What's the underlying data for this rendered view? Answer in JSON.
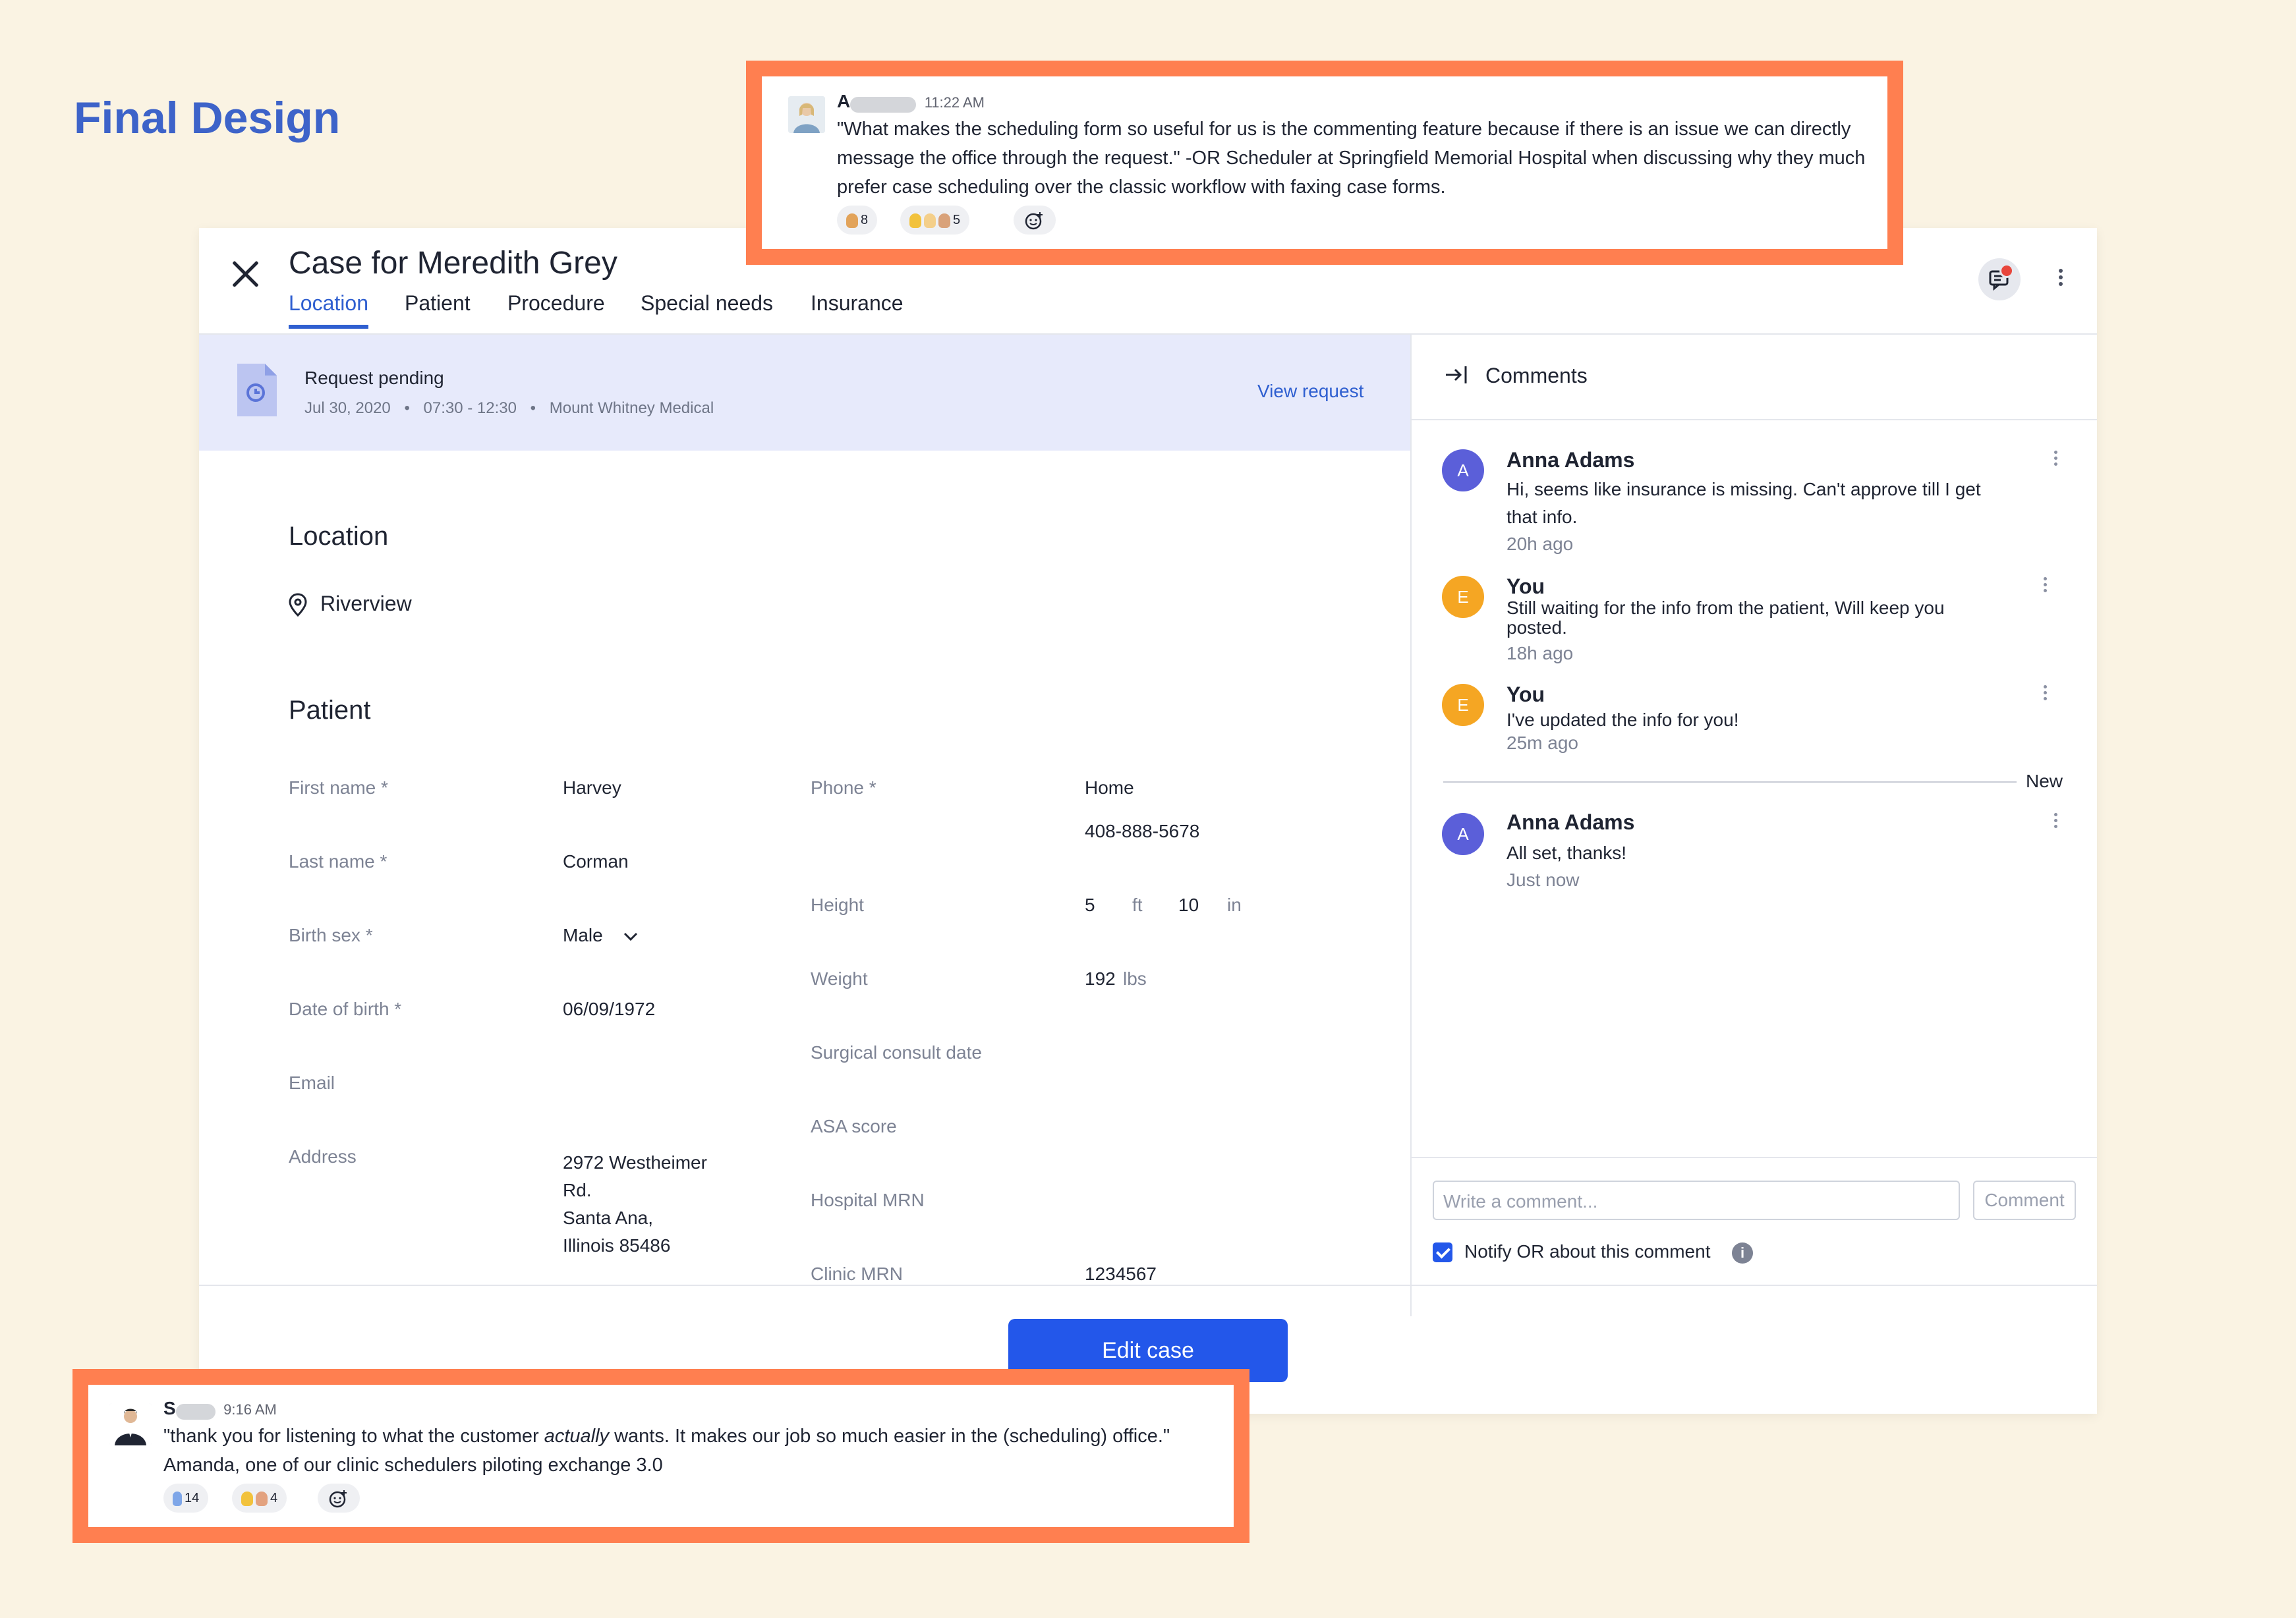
{
  "page": {
    "title": "Final Design"
  },
  "quote_top": {
    "name_initial": "A",
    "time": "11:22 AM",
    "text_line1": "\"What makes the scheduling form so useful for us is the commenting feature because if there is an issue we can directly",
    "text_line2": "message the office through the request.\"  -OR Scheduler at Springfield Memorial Hospital when discussing why they much",
    "text_line3": "prefer case scheduling over the classic workflow with faxing case forms.",
    "reactions": [
      "8",
      "5"
    ]
  },
  "quote_bottom": {
    "name_initial": "S",
    "time": "9:16 AM",
    "text_before": "\"thank you for listening to what the customer ",
    "text_em": "actually",
    "text_after": " wants. It makes our job so much easier in the (scheduling) office.\"",
    "text_line2": "Amanda, one of our clinic schedulers piloting exchange 3.0",
    "reactions": [
      "14",
      "4"
    ]
  },
  "case": {
    "title": "Case for Meredith Grey",
    "tabs": [
      "Location",
      "Patient",
      "Procedure",
      "Special needs",
      "Insurance"
    ],
    "active_tab": "Location"
  },
  "request": {
    "title": "Request pending",
    "date": "Jul 30, 2020",
    "sep": "•",
    "time": "07:30 - 12:30",
    "facility": "Mount Whitney Medical",
    "link": "View request"
  },
  "location": {
    "heading": "Location",
    "value": "Riverview"
  },
  "patient": {
    "heading": "Patient",
    "first_name_label": "First name *",
    "first_name": "Harvey",
    "last_name_label": "Last name *",
    "last_name": "Corman",
    "birth_sex_label": "Birth sex *",
    "birth_sex": "Male",
    "dob_label": "Date of birth *",
    "dob": "06/09/1972",
    "email_label": "Email",
    "address_label": "Address",
    "address_lines": [
      "2972 Westheimer",
      "Rd.",
      "Santa Ana,",
      "Illinois 85486"
    ],
    "phone_label": "Phone *",
    "phone_type": "Home",
    "phone": "408-888-5678",
    "height_label": "Height",
    "height_ft": "5",
    "ft_unit": "ft",
    "height_in": "10",
    "in_unit": "in",
    "weight_label": "Weight",
    "weight": "192",
    "weight_unit": "lbs",
    "consult_label": "Surgical consult date",
    "asa_label": "ASA score",
    "hospital_mrn_label": "Hospital MRN",
    "clinic_mrn_label": "Clinic MRN",
    "clinic_mrn": "1234567"
  },
  "edit_button": "Edit case",
  "comments": {
    "heading": "Comments",
    "items": [
      {
        "initial": "A",
        "name": "Anna Adams",
        "line1": "Hi, seems like insurance is missing. Can't approve till I get",
        "line2": "that info.",
        "time": "20h ago"
      },
      {
        "initial": "E",
        "name": "You",
        "line1": "Still waiting for the info from the patient, Will keep you",
        "line2": "posted.",
        "time": "18h ago"
      },
      {
        "initial": "E",
        "name": "You",
        "line1": "I've updated the info for you!",
        "time": "25m ago"
      },
      {
        "initial": "A",
        "name": "Anna Adams",
        "line1": "All set, thanks!",
        "time": "Just now"
      }
    ],
    "new_label": "New",
    "input_placeholder": "Write a comment...",
    "button": "Comment",
    "notify": "Notify OR about this comment",
    "info": "i"
  },
  "colors": {
    "accent": "#2357ea",
    "quote_border": "#ff7f50",
    "title": "#3d63c9",
    "background": "#faf3e3"
  }
}
